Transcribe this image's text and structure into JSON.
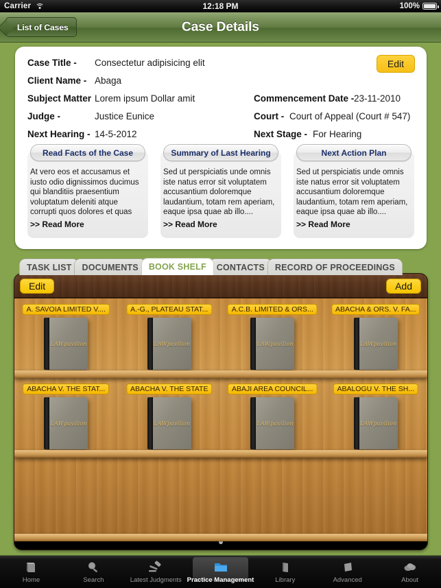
{
  "statusbar": {
    "carrier": "Carrier",
    "wifi_icon": "wifi-icon",
    "time": "12:18 PM",
    "battery_percent": "100%",
    "battery_icon": "battery-full-icon"
  },
  "navbar": {
    "back_label": "List of Cases",
    "title": "Case Details"
  },
  "case": {
    "edit_label": "Edit",
    "labels": {
      "case_title": "Case Title -",
      "client_name": "Client Name -",
      "subject_matter": "Subject Matter",
      "judge": "Judge -",
      "next_hearing": "Next Hearing -",
      "commencement_date": "Commencement Date -",
      "court": "Court -",
      "next_stage": "Next Stage -"
    },
    "values": {
      "case_title": "Consectetur adipisicing elit",
      "client_name": "Abaga",
      "subject_matter": "Lorem ipsum Dollar amit",
      "judge": "Justice Eunice",
      "next_hearing": "14-5-2012",
      "commencement_date": "23-11-2010",
      "court": "Court of Appeal (Court # 547)",
      "next_stage": "For Hearing"
    }
  },
  "panels": [
    {
      "title": "Read Facts of the Case",
      "body": "At vero eos et accusamus et iusto odio dignissimos ducimus qui blanditiis praesentium voluptatum deleniti atque corrupti quos dolores et quas",
      "more": ">> Read More"
    },
    {
      "title": "Summary of Last Hearing",
      "body": "Sed ut perspiciatis unde omnis iste natus error sit voluptatem accusantium doloremque laudantium, totam rem aperiam, eaque ipsa quae ab illo....",
      "more": ">> Read More"
    },
    {
      "title": "Next Action Plan",
      "body": "Sed ut perspiciatis unde omnis iste natus error sit voluptatem accusantium doloremque laudantium, totam rem aperiam, eaque ipsa quae ab illo....",
      "more": ">> Read More"
    }
  ],
  "tabs": [
    {
      "label": "TASK LIST",
      "active": false
    },
    {
      "label": "DOCUMENTS",
      "active": false
    },
    {
      "label": "BOOK SHELF",
      "active": true
    },
    {
      "label": "CONTACTS",
      "active": false
    },
    {
      "label": "RECORD OF PROCEEDINGS",
      "active": false
    }
  ],
  "bookshelf": {
    "edit_label": "Edit",
    "add_label": "Add",
    "book_cover_text": "LAWpavilion",
    "rows": [
      [
        {
          "label": "A. SAVOIA LIMITED V...."
        },
        {
          "label": "A.-G., PLATEAU STAT..."
        },
        {
          "label": "A.C.B. LIMITED & ORS..."
        },
        {
          "label": "ABACHA & ORS. V. FA..."
        }
      ],
      [
        {
          "label": "ABACHA V. THE STAT..."
        },
        {
          "label": "ABACHA V. THE STATE"
        },
        {
          "label": "ABAJI AREA COUNCIL..."
        },
        {
          "label": "ABALOGU V. THE SH..."
        }
      ],
      []
    ],
    "page_dots": 1,
    "current_page": 1
  },
  "tabbar": [
    {
      "label": "Home",
      "icon": "home-book-icon",
      "selected": false
    },
    {
      "label": "Search",
      "icon": "search-magnifier-icon",
      "selected": false
    },
    {
      "label": "Latest Judgments",
      "icon": "gavel-icon",
      "selected": false
    },
    {
      "label": "Practice Management",
      "icon": "folder-icon",
      "selected": true
    },
    {
      "label": "Library",
      "icon": "library-book-icon",
      "selected": false
    },
    {
      "label": "Advanced",
      "icon": "advanced-tag-icon",
      "selected": false
    },
    {
      "label": "About",
      "icon": "about-cloud-icon",
      "selected": false
    }
  ],
  "colors": {
    "background_green": "#86a44e",
    "accent_yellow": "#f7c200",
    "panel_title_blue": "#1b2f6b",
    "active_tab_green": "#86a44e"
  }
}
